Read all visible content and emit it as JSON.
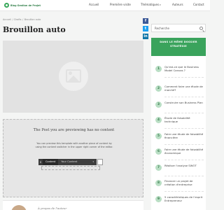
{
  "brand": {
    "name": "Blog Gestion de Projet"
  },
  "nav": [
    {
      "label": "Accueil",
      "has_dropdown": false
    },
    {
      "label": "Première visite",
      "has_dropdown": false
    },
    {
      "label": "Thématiques",
      "has_dropdown": true
    },
    {
      "label": "Auteurs",
      "has_dropdown": false
    },
    {
      "label": "Contact",
      "has_dropdown": false
    }
  ],
  "breadcrumb": [
    "Accueil",
    "Drafts",
    "Brouillon auto"
  ],
  "page_title": "Brouillon auto",
  "preview": {
    "title": "The Post you are previewing has no content",
    "text": "You can preview this template with another piece of content by using the content switcher in the upper right corner of the editor.",
    "bar_label": "Content",
    "bar_select": "Your Content"
  },
  "author": {
    "label": "À propos de l'auteur"
  },
  "social": {
    "facebook": "f",
    "twitter": "t",
    "linkedin": "in"
  },
  "search": {
    "placeholder": "Recherche"
  },
  "sidebar": {
    "heading": "DANS LE MÊME DOSSIER STRATÉGIE",
    "items": [
      {
        "num": "1",
        "text": "Qu'est-ce que le Business Model Canvas ?"
      },
      {
        "num": "2",
        "text": "Comment faire une étude de marché?"
      },
      {
        "num": "3",
        "text": "Construire son Business Plan"
      },
      {
        "num": "4",
        "text": "Étude de faisabilité technique"
      },
      {
        "num": "5",
        "text": "Faire une étude de faisabilité financière"
      },
      {
        "num": "6",
        "text": "Faire une étude de faisabilité économique"
      },
      {
        "num": "7",
        "text": "Réaliser l'analyse SWOT"
      },
      {
        "num": "8",
        "text": "Financer un projet de création d'entreprise"
      },
      {
        "num": "9",
        "text": "5 caractéristiques de l'esprit Entrepreneur"
      }
    ]
  },
  "colors": {
    "accent": "#3aa35c",
    "badge": "#b9dec4",
    "facebook": "#3b5998",
    "twitter": "#1da1f2",
    "linkedin": "#0e76a8"
  },
  "icons": [
    "logo-icon",
    "image-placeholder-icon",
    "search-icon",
    "facebook-icon",
    "twitter-icon",
    "linkedin-icon",
    "drag-handle-icon",
    "chevron-down-icon"
  ]
}
